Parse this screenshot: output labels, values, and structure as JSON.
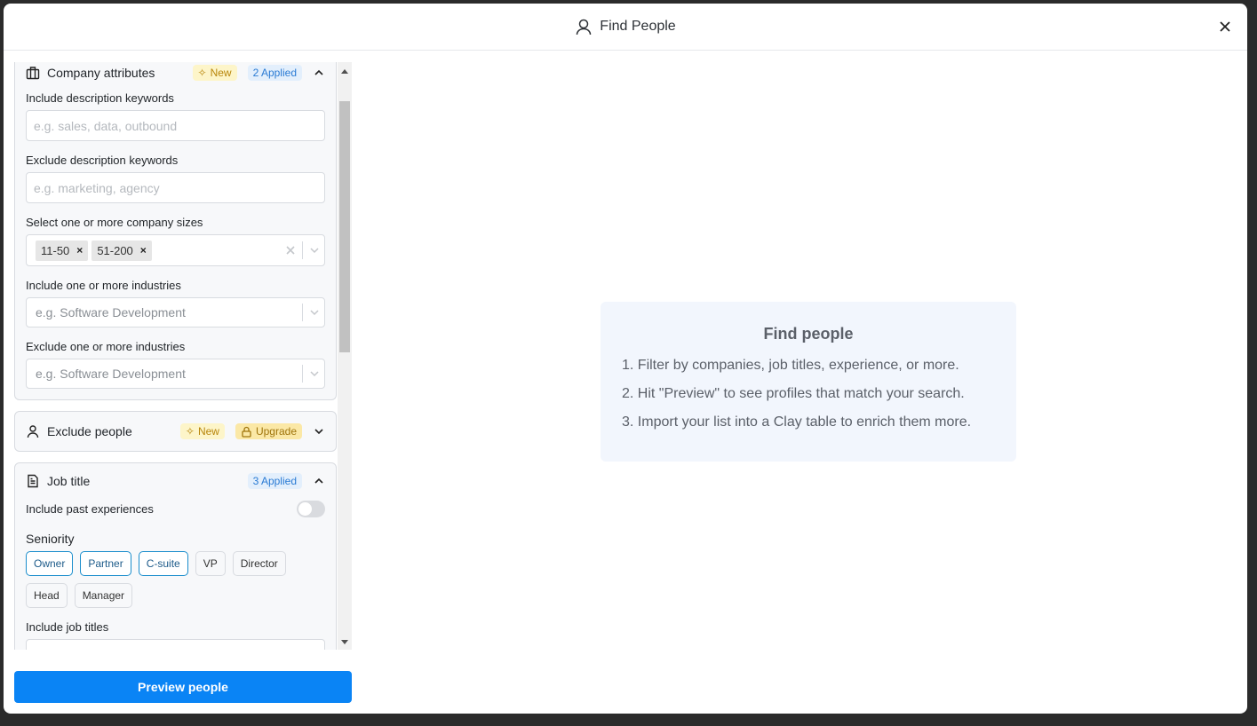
{
  "header": {
    "title": "Find People",
    "icon": "user-icon",
    "close_icon": "close-icon"
  },
  "sections": {
    "company": {
      "name": "Company attributes",
      "icon": "building-icon",
      "new_badge": "New",
      "applied_badge": "2 Applied",
      "include_desc_label": "Include description keywords",
      "include_desc_placeholder": "e.g. sales, data, outbound",
      "exclude_desc_label": "Exclude description keywords",
      "exclude_desc_placeholder": "e.g. marketing, agency",
      "sizes_label": "Select one or more company sizes",
      "sizes_selected": [
        "11-50",
        "51-200"
      ],
      "include_ind_label": "Include one or more industries",
      "include_ind_placeholder": "e.g. Software Development",
      "exclude_ind_label": "Exclude one or more industries",
      "exclude_ind_placeholder": "e.g. Software Development"
    },
    "exclude_people": {
      "name": "Exclude people",
      "icon": "user-icon",
      "new_badge": "New",
      "upgrade_badge": "Upgrade"
    },
    "job_title": {
      "name": "Job title",
      "icon": "document-icon",
      "applied_badge": "3 Applied",
      "past_exp_label": "Include past experiences",
      "past_exp_enabled": false,
      "seniority_label": "Seniority",
      "seniority": [
        {
          "label": "Owner",
          "selected": true
        },
        {
          "label": "Partner",
          "selected": true
        },
        {
          "label": "C-suite",
          "selected": true
        },
        {
          "label": "VP",
          "selected": false
        },
        {
          "label": "Director",
          "selected": false
        },
        {
          "label": "Head",
          "selected": false
        },
        {
          "label": "Manager",
          "selected": false
        }
      ],
      "include_titles_label": "Include job titles"
    }
  },
  "preview_button": "Preview people",
  "info": {
    "title": "Find people",
    "steps": [
      "1. Filter by companies, job titles, experience, or more.",
      "2. Hit \"Preview\" to see profiles that match your search.",
      "3. Import your list into a Clay table to enrich them more."
    ]
  },
  "colors": {
    "accent": "#0a84f5",
    "selected_pill": "#1a8dcc",
    "applied": "#2a7bd4",
    "new": "#b8860b"
  }
}
